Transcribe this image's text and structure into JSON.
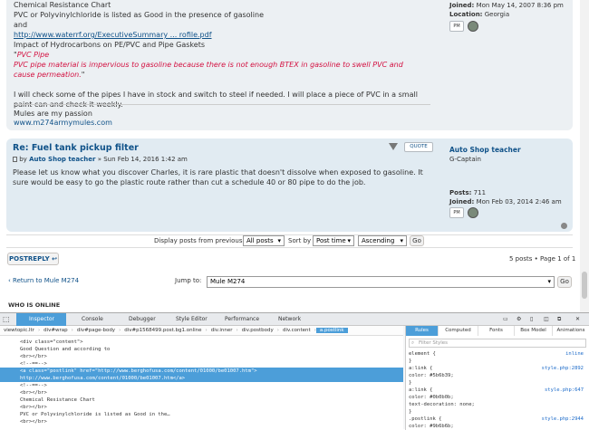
{
  "post1": {
    "lines": [
      "Chemical Resistance Chart",
      "PVC or Polyvinylchloride is listed as Good in the presence of gasoline",
      "and",
      "Impact of Hydrocarbons on PE/PVC and Pipe Gaskets"
    ],
    "link1": "http://www.waterrf.org/ExecutiveSummary ... rofile.pdf",
    "quote_open": "\"",
    "quote_title": "PVC Pipe",
    "quote_body": "PVC pipe material is impervious to gasoline because there is not enough BTEX in gasoline to swell PVC and cause permeation.",
    "quote_close": "\"",
    "body": "I will check some of the pipes I have in stock and switch to steel if needed. I will place a piece of PVC in a small paint can and check it weekly.",
    "sig_text": "Mules are my passion",
    "sig_link": "www.m274armymules.com",
    "profile": {
      "joined_label": "Joined:",
      "joined": "Mon May 14, 2007 8:36 pm",
      "location_label": "Location:",
      "location": "Georgia"
    }
  },
  "post2": {
    "title": "Re: Fuel tank pickup filter",
    "by": "by",
    "author": "Auto Shop teacher",
    "date": "» Sun Feb 14, 2016 1:42 am",
    "quote_btn": "QUOTE",
    "body": "Please let us know what you discover Charles, it is rare plastic that doesn't dissolve when exposed to gasoline. It sure would be easy to go the plastic route rather than cut a schedule 40 or 80 pipe to do the job.",
    "profile": {
      "name": "Auto Shop teacher",
      "rank": "G-Captain",
      "posts_label": "Posts:",
      "posts": "711",
      "joined_label": "Joined:",
      "joined": "Mon Feb 03, 2014 2:46 am"
    }
  },
  "pm_label": "PM",
  "display": {
    "label": "Display posts from previous:",
    "posts_value": "All posts",
    "sort_label": "Sort by",
    "sort_value": "Post time",
    "order_value": "Ascending",
    "go": "Go"
  },
  "postreply": "POSTREPLY",
  "pagination": "5 posts • Page 1 of 1",
  "return_link": "‹ Return to Mule M274",
  "jump_label": "Jump to:",
  "jump_value": "Mule M274",
  "jump_go": "Go",
  "who_online": "WHO IS ONLINE",
  "devtools": {
    "tabs": [
      "Inspector",
      "Console",
      "Debugger",
      "Style Editor",
      "Performance",
      "Network"
    ],
    "breadcrumbs": [
      "viewtopic.ltr",
      "div#wrap",
      "div#page-body",
      "div#p1568499.post.bg1.online",
      "div.inner",
      "div.postbody",
      "div.content",
      "a.postlink"
    ],
    "markup": [
      "<div class=\"content\">",
      "  Good Question and according to",
      "  <br></br>",
      "  <!--==-->",
      "  <a class=\"postlink\" href=\"http://www.berghofusa.com/content/01000/be01007.htm\">",
      "  http://www.berghofusa.com/content/01000/be01007.htm</a>",
      "  <!--==-->",
      "  <br></br>",
      "  Chemical Resistance Chart",
      "  <br></br>",
      "  PVC or Polyvinylchloride is listed as Good in the…",
      "  <br></br>"
    ],
    "rule_tabs": [
      "Rules",
      "Computed",
      "Fonts",
      "Box Model",
      "Animations"
    ],
    "filter_placeholder": "Filter Styles",
    "rules": [
      {
        "sel": "element {",
        "src": "inline"
      },
      {
        "sel": "}",
        "src": ""
      },
      {
        "sel": "a:link {",
        "src": "style.php:2892"
      },
      {
        "sel": "  color: #5b6b39;",
        "src": ""
      },
      {
        "sel": "}",
        "src": ""
      },
      {
        "sel": "a:link {",
        "src": "style.php:647"
      },
      {
        "sel": "  color: #0b0b0b;",
        "src": ""
      },
      {
        "sel": "  text-decoration: none;",
        "src": ""
      },
      {
        "sel": "}",
        "src": ""
      },
      {
        "sel": ".postlink {",
        "src": "style.php:2944"
      },
      {
        "sel": "  color: #9b6b6b;",
        "src": ""
      }
    ]
  },
  "colors": {
    "link": "#105289",
    "red_quote": "#d31141",
    "post_bg": "#ecf0f3",
    "highlight": "#4c9ed9"
  }
}
